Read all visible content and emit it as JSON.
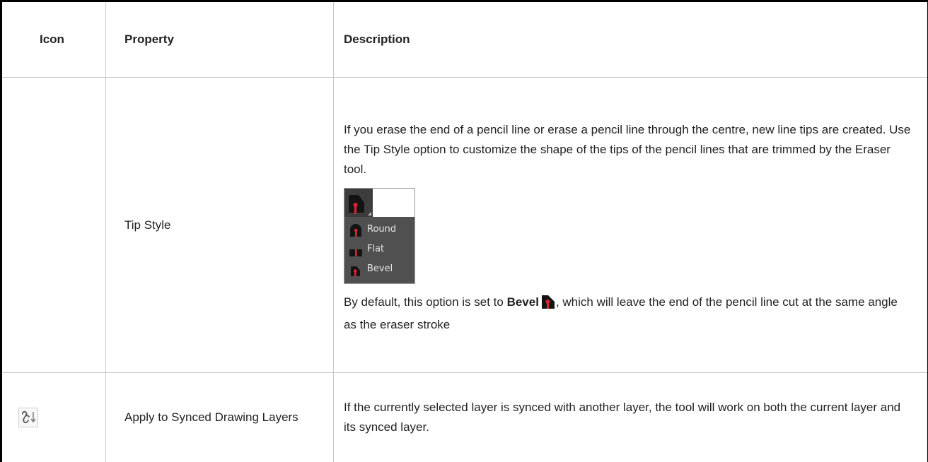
{
  "table": {
    "headers": {
      "icon": "Icon",
      "property": "Property",
      "description": "Description"
    },
    "rows": [
      {
        "icon": "",
        "property": "Tip Style",
        "description_p1": "If you erase the end of a pencil line or erase a pencil line through the centre, new line tips are created. Use the Tip Style option to customize the shape of the tips of the pencil lines that are trimmed by the Eraser tool.",
        "tip_menu": {
          "selected_icon": "bevel-tip-icon",
          "options": [
            "Round",
            "Flat",
            "Bevel"
          ]
        },
        "description_p2_prefix": "By default, this option is set to ",
        "description_p2_bold": "Bevel",
        "description_p2_suffix": ", which will leave the end of the pencil line cut at the same angle as the eraser stroke"
      },
      {
        "icon": "sync-link-icon",
        "property": "Apply to Synced Drawing Layers",
        "description": "If the currently selected layer is synced with another layer, the tool will work on both the current layer and its synced layer."
      }
    ]
  },
  "colors": {
    "tip_red": "#e0242c",
    "menu_bg": "#505050",
    "button_bg": "#3d3d3d"
  }
}
